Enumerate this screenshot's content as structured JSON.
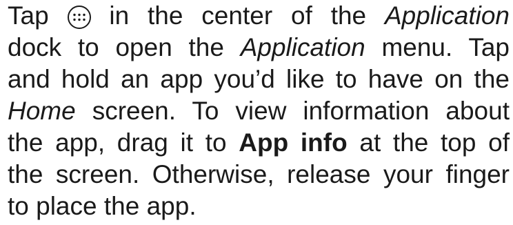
{
  "instructions": {
    "line1": {
      "a": "Tap",
      "icon": "app-grid-icon",
      "b": "in the center of the",
      "c": "Application"
    },
    "line2": {
      "a": "dock to open the",
      "b": "Application",
      "c": "menu. Tap"
    },
    "line3": "and hold an app you’d like to have on the",
    "line4": {
      "a": "Home",
      "b": "screen. To view information about"
    },
    "line5": {
      "a": "the app, drag it to",
      "b": "App info",
      "c": "at the top of"
    },
    "line6": "the screen. Otherwise, release your finger",
    "line7": "to place the app."
  }
}
